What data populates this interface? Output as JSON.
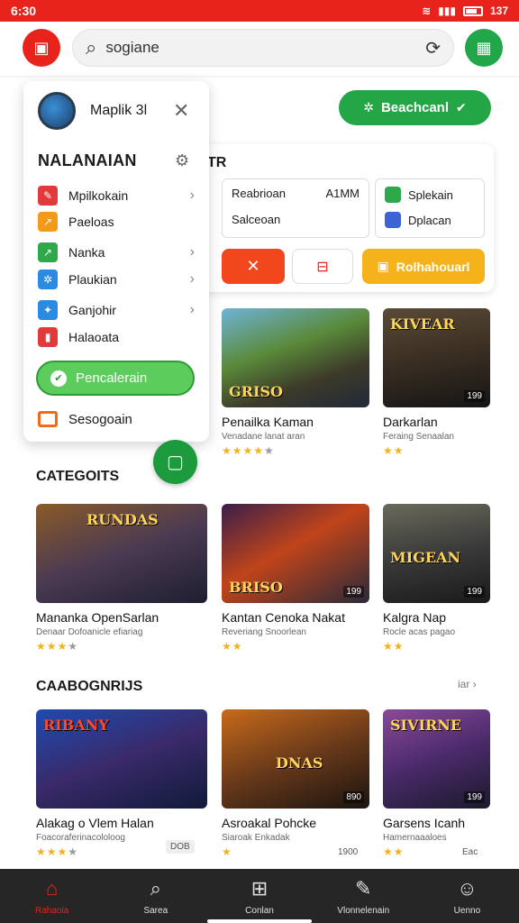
{
  "status_bar": {
    "time": "6:30",
    "battery": "137"
  },
  "search": {
    "value": "sogiane"
  },
  "header": {
    "button_label": "Beachcanl"
  },
  "panel": {
    "title": "TR",
    "box1": {
      "line1_left": "Reabrioan",
      "line1_right": "A1MM",
      "line2": "Salceoan"
    },
    "box2": {
      "row1": "Splekain",
      "row2": "Dplacan"
    },
    "action3_label": "Rolhahouarl"
  },
  "drawer": {
    "username": "Maplik 3l",
    "heading": "NALANAIAN",
    "items": [
      {
        "label": "Mpilkokain",
        "color": "#e23a3a"
      },
      {
        "label": "Paeloas",
        "color": "#f39a1a"
      },
      {
        "label": "Nanka",
        "color": "#2ea84a"
      },
      {
        "label": "Plaukian",
        "color": "#2b8be0"
      },
      {
        "label": "Ganjohir",
        "color": "#2b8be0"
      },
      {
        "label": "Halaoata",
        "color": "#e23a3a"
      }
    ],
    "cta_label": "Pencalerain",
    "footer_label": "Sesogoain"
  },
  "sections": [
    {
      "title": "",
      "cards": [
        {
          "title": "Penailka Kaman",
          "sub": "Venadane lanat aran",
          "stars": 4,
          "badge": "",
          "wm": "GRISO"
        },
        {
          "title": "Darkarlan",
          "sub": "Feraing Senaalan",
          "stars": 2,
          "badge": "199",
          "wm": "KIVEAR"
        }
      ]
    },
    {
      "title": "CATEGOITS",
      "cards": [
        {
          "title": "Mananka OpenSarlan",
          "sub": "Denaar Dofoanicle efiariag",
          "stars": 3,
          "badge": "",
          "wm": "RUNDAS"
        },
        {
          "title": "Kantan Cenoka Nakat",
          "sub": "Reveriang Snoorlean",
          "stars": 2,
          "badge": "199",
          "wm": "BRISO"
        },
        {
          "title": "Kalgra Nap",
          "sub": "Rocle acas pagao",
          "stars": 2,
          "badge": "199",
          "wm": "MIGEAN"
        }
      ]
    },
    {
      "title": "CAABOGNRIJS",
      "see_all": "iar",
      "cards": [
        {
          "title": "Alakag o Vlem Halan",
          "sub": "Foacoraferinacololoog",
          "stars": 3,
          "badge": "",
          "wm": "RIBANY",
          "tag": "DOB"
        },
        {
          "title": "Asroakal Pohcke",
          "sub": "Siaroak Enkadak",
          "stars": 1,
          "badge": "890",
          "wm": "DNAS",
          "tag": "1900"
        },
        {
          "title": "Garsens Icanh",
          "sub": "Hamernaaaloes",
          "stars": 2,
          "badge": "199",
          "wm": "SIVIRNE",
          "tag": "Eac"
        }
      ]
    }
  ],
  "bottom_nav": [
    {
      "label": "Rahaoia",
      "icon": "home-icon"
    },
    {
      "label": "Sarea",
      "icon": "search-icon"
    },
    {
      "label": "Conlan",
      "icon": "plus-icon"
    },
    {
      "label": "Vlonnelenain",
      "icon": "notification-icon"
    },
    {
      "label": "Uenno",
      "icon": "profile-icon"
    }
  ],
  "colors": {
    "brand_red": "#e8231c",
    "brand_green": "#23a746",
    "accent_orange": "#f5b21a"
  }
}
